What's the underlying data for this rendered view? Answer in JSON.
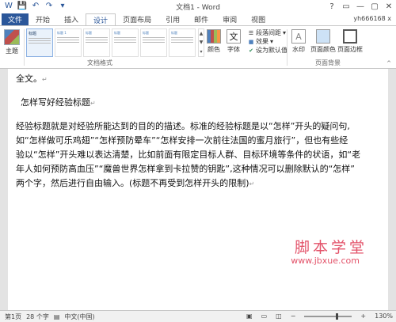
{
  "window": {
    "title": "文档1 - Word",
    "account": "yh666168 x",
    "controls": [
      "?",
      "▭",
      "—",
      "▢",
      "✕"
    ]
  },
  "qat": {
    "icons": [
      "W",
      "💾",
      "↶",
      "↷",
      "▾"
    ]
  },
  "tabs": [
    "文件",
    "开始",
    "插入",
    "设计",
    "页面布局",
    "引用",
    "邮件",
    "审阅",
    "视图"
  ],
  "ribbon": {
    "theme_label": "主题",
    "style_thumbs": [
      "标题",
      "标题 1",
      "标题",
      "标题",
      "标题",
      "标题"
    ],
    "group_doc_format": "文档格式",
    "colors_label": "颜色",
    "fonts_label": "字体",
    "fonts_icon_char": "文",
    "paragraph_spacing": "段落间距",
    "effects": "效果",
    "set_default": "设为默认值",
    "watermark": "水印",
    "page_color": "页面颜色",
    "page_borders": "页面边框",
    "group_page_bg": "页面背景"
  },
  "document": {
    "line1": "全文。",
    "heading": "怎样写好经验标题",
    "para": [
      "经验标题就是对经验所能达到的目的的描述。标准的经验标题是以“怎样”开头的疑问句,",
      "如“怎样做可乐鸡翅”“怎样预防晕车”“怎样安排一次前往法国的蜜月旅行”，但也有些经",
      "验以“怎样”开头难以表达清楚，比如前面有限定目标人群、目标环境等条件的状语，如“老",
      "年人如何预防高血压”“魔兽世界怎样拿到卡拉赞的钥匙”,这种情况可以删除默认的“怎样”",
      "两个字，然后进行自由输入。(标题不再受到怎样开头的限制)"
    ],
    "para_mark": "↵"
  },
  "watermark": {
    "line1": "脚本学堂",
    "line2": "www.jbxue.com"
  },
  "status": {
    "page": "第1页",
    "words": "28 个字",
    "lang": "中文(中国)",
    "zoom": "130%"
  }
}
